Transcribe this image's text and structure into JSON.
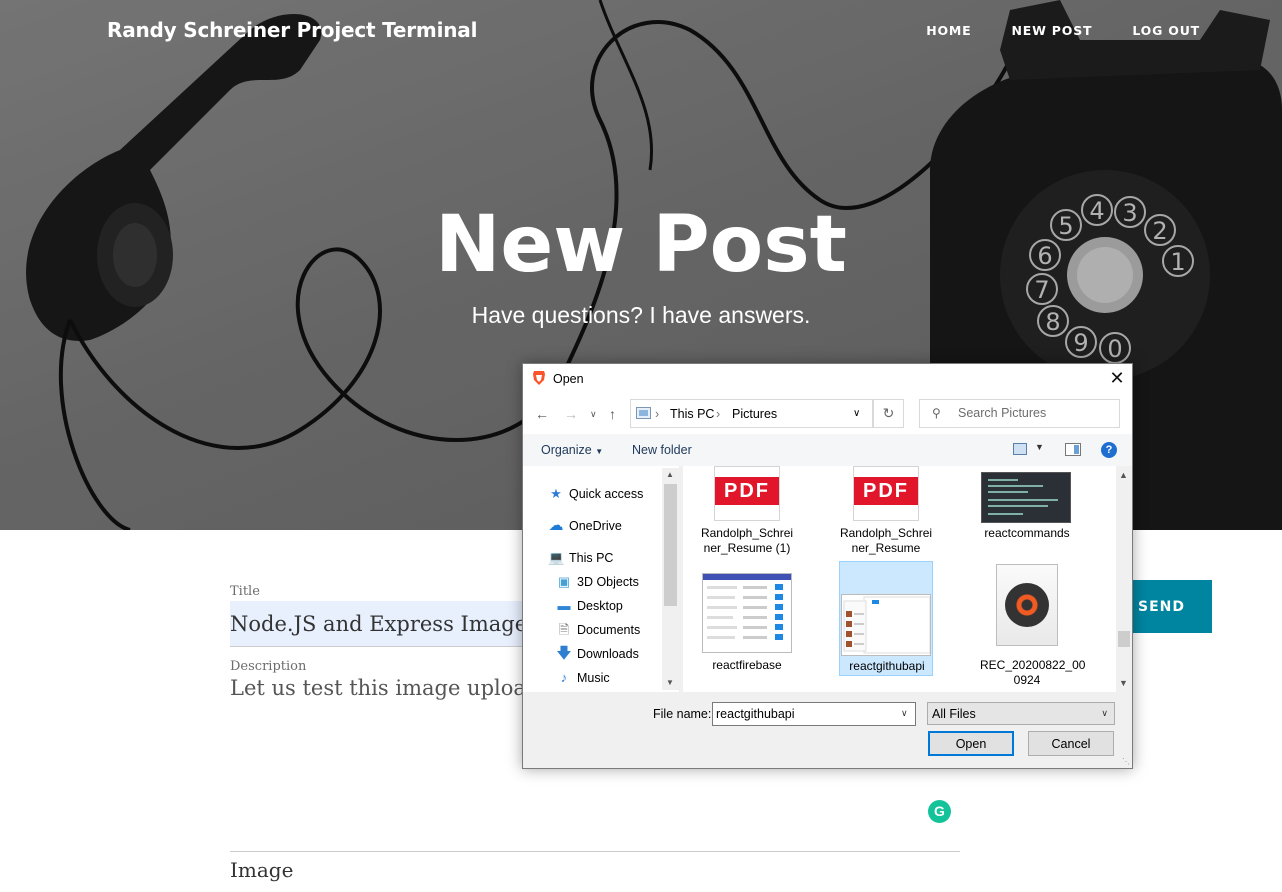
{
  "site": {
    "brand": "Randy Schreiner Project Terminal",
    "nav": [
      "HOME",
      "NEW POST",
      "LOG OUT"
    ]
  },
  "hero": {
    "title": "New Post",
    "subtitle": "Have questions? I have answers."
  },
  "form": {
    "title_label": "Title",
    "title_value": "Node.JS and Express Image up",
    "description_label": "Description",
    "description_value": "Let us test this image upload.",
    "image_label": "Image",
    "send_label": "SEND",
    "grammarly_glyph": "G"
  },
  "dialog": {
    "title": "Open",
    "close_glyph": "✕",
    "breadcrumb": [
      "This PC",
      "Pictures"
    ],
    "search_placeholder": "Search Pictures",
    "toolbar": {
      "organize": "Organize",
      "new_folder": "New folder",
      "help": "?"
    },
    "nav_items": [
      {
        "label": "Quick access",
        "icon": "star-icon"
      },
      {
        "label": "OneDrive",
        "icon": "cloud-icon"
      },
      {
        "label": "This PC",
        "icon": "computer-icon"
      },
      {
        "label": "3D Objects",
        "icon": "cube-icon"
      },
      {
        "label": "Desktop",
        "icon": "desktop-icon"
      },
      {
        "label": "Documents",
        "icon": "document-icon"
      },
      {
        "label": "Downloads",
        "icon": "download-arrow-icon"
      },
      {
        "label": "Music",
        "icon": "music-note-icon"
      }
    ],
    "files": [
      {
        "name": "Randolph_Schreiner_Resume (1)",
        "line1": "Randolph_Schrei",
        "line2": "ner_Resume (1)",
        "kind": "pdf"
      },
      {
        "name": "Randolph_Schreiner_Resume",
        "line1": "Randolph_Schrei",
        "line2": "ner_Resume",
        "kind": "pdf"
      },
      {
        "name": "reactcommands",
        "line1": "reactcommands",
        "kind": "image"
      },
      {
        "name": "reactfirebase",
        "line1": "reactfirebase",
        "kind": "image"
      },
      {
        "name": "reactgithubapi",
        "line1": "reactgithubapi",
        "kind": "image",
        "selected": true
      },
      {
        "name": "REC_20200822_000924",
        "line1": "REC_20200822_00",
        "line2": "0924",
        "kind": "audio"
      }
    ],
    "pdf_badge": "PDF",
    "file_name_label": "File name:",
    "file_name_value": "reactgithubapi",
    "filter_value": "All Files",
    "open_button": "Open",
    "cancel_button": "Cancel"
  },
  "colors": {
    "send_button": "#0085a1",
    "title_input_bg": "#e8f0fe",
    "selection": "#cce8ff",
    "pdf_red": "#e2162b",
    "accent_blue": "#0078d7"
  }
}
